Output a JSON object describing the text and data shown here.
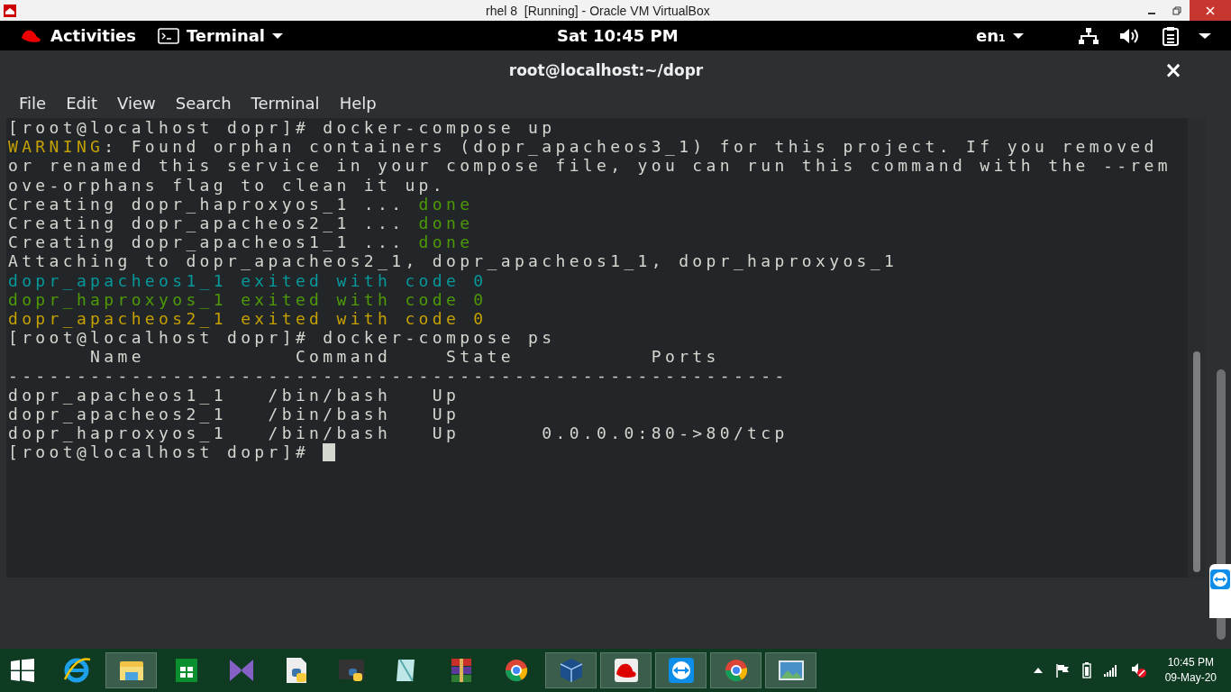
{
  "host_window": {
    "title": "rhel 8  [Running] - Oracle VM VirtualBox"
  },
  "top_bar": {
    "activities": "Activities",
    "app_menu": "Terminal",
    "clock": "Sat 10:45 PM",
    "input_source": "en₁"
  },
  "terminal": {
    "title": "root@localhost:~/dopr",
    "close": "×",
    "menu": [
      "File",
      "Edit",
      "View",
      "Search",
      "Terminal",
      "Help"
    ],
    "lines": [
      {
        "segments": [
          {
            "text": "[root@localhost dopr]# docker-compose up",
            "color": "#d3d7cf"
          }
        ]
      },
      {
        "segments": [
          {
            "text": "WARNING",
            "color": "#c4a000"
          },
          {
            "text": ": Found orphan containers (dopr_apacheos3_1) for this project. If you removed",
            "color": "#d3d7cf"
          }
        ]
      },
      {
        "segments": [
          {
            "text": "or renamed this service in your compose file, you can run this command with the --rem",
            "color": "#d3d7cf"
          }
        ]
      },
      {
        "segments": [
          {
            "text": "ove-orphans flag to clean it up.",
            "color": "#d3d7cf"
          }
        ]
      },
      {
        "segments": [
          {
            "text": "Creating dopr_haproxyos_1 ... ",
            "color": "#d3d7cf"
          },
          {
            "text": "done",
            "color": "#4e9a06"
          }
        ]
      },
      {
        "segments": [
          {
            "text": "Creating dopr_apacheos2_1 ... ",
            "color": "#d3d7cf"
          },
          {
            "text": "done",
            "color": "#4e9a06"
          }
        ]
      },
      {
        "segments": [
          {
            "text": "Creating dopr_apacheos1_1 ... ",
            "color": "#d3d7cf"
          },
          {
            "text": "done",
            "color": "#4e9a06"
          }
        ]
      },
      {
        "segments": [
          {
            "text": "Attaching to dopr_apacheos2_1, dopr_apacheos1_1, dopr_haproxyos_1",
            "color": "#d3d7cf"
          }
        ]
      },
      {
        "segments": [
          {
            "text": "dopr_apacheos1_1 exited with code 0",
            "color": "#06989a"
          }
        ]
      },
      {
        "segments": [
          {
            "text": "dopr_haproxyos_1 exited with code 0",
            "color": "#4e9a06"
          }
        ]
      },
      {
        "segments": [
          {
            "text": "dopr_apacheos2_1 exited with code 0",
            "color": "#c4a000"
          }
        ]
      },
      {
        "segments": [
          {
            "text": "[root@localhost dopr]# docker-compose ps",
            "color": "#d3d7cf"
          }
        ]
      },
      {
        "segments": [
          {
            "text": "      Name           Command    State          Ports",
            "color": "#d3d7cf"
          }
        ]
      },
      {
        "segments": [
          {
            "text": "---------------------------------------------------------",
            "color": "#d3d7cf"
          }
        ]
      },
      {
        "segments": [
          {
            "text": "dopr_apacheos1_1   /bin/bash   Up",
            "color": "#d3d7cf"
          }
        ]
      },
      {
        "segments": [
          {
            "text": "dopr_apacheos2_1   /bin/bash   Up",
            "color": "#d3d7cf"
          }
        ]
      },
      {
        "segments": [
          {
            "text": "dopr_haproxyos_1   /bin/bash   Up      0.0.0.0:80->80/tcp",
            "color": "#d3d7cf"
          }
        ]
      },
      {
        "segments": [
          {
            "text": "[root@localhost dopr]# ",
            "color": "#d3d7cf"
          }
        ],
        "cursor": true
      }
    ]
  },
  "taskbar": {
    "apps": [
      {
        "kind": "ie",
        "open": false
      },
      {
        "kind": "explorer",
        "open": true
      },
      {
        "kind": "store",
        "open": false
      },
      {
        "kind": "vs",
        "open": false
      },
      {
        "kind": "pyfile",
        "open": false
      },
      {
        "kind": "idle",
        "open": false
      },
      {
        "kind": "notepad",
        "open": false
      },
      {
        "kind": "winrar",
        "open": false
      },
      {
        "kind": "chrome",
        "open": false
      },
      {
        "kind": "vbox",
        "open": true
      },
      {
        "kind": "redhat",
        "open": true
      },
      {
        "kind": "teamviewer",
        "open": true
      },
      {
        "kind": "chrome",
        "open": true
      },
      {
        "kind": "photos",
        "open": true
      }
    ],
    "time": "10:45 PM",
    "date": "09-May-20"
  }
}
